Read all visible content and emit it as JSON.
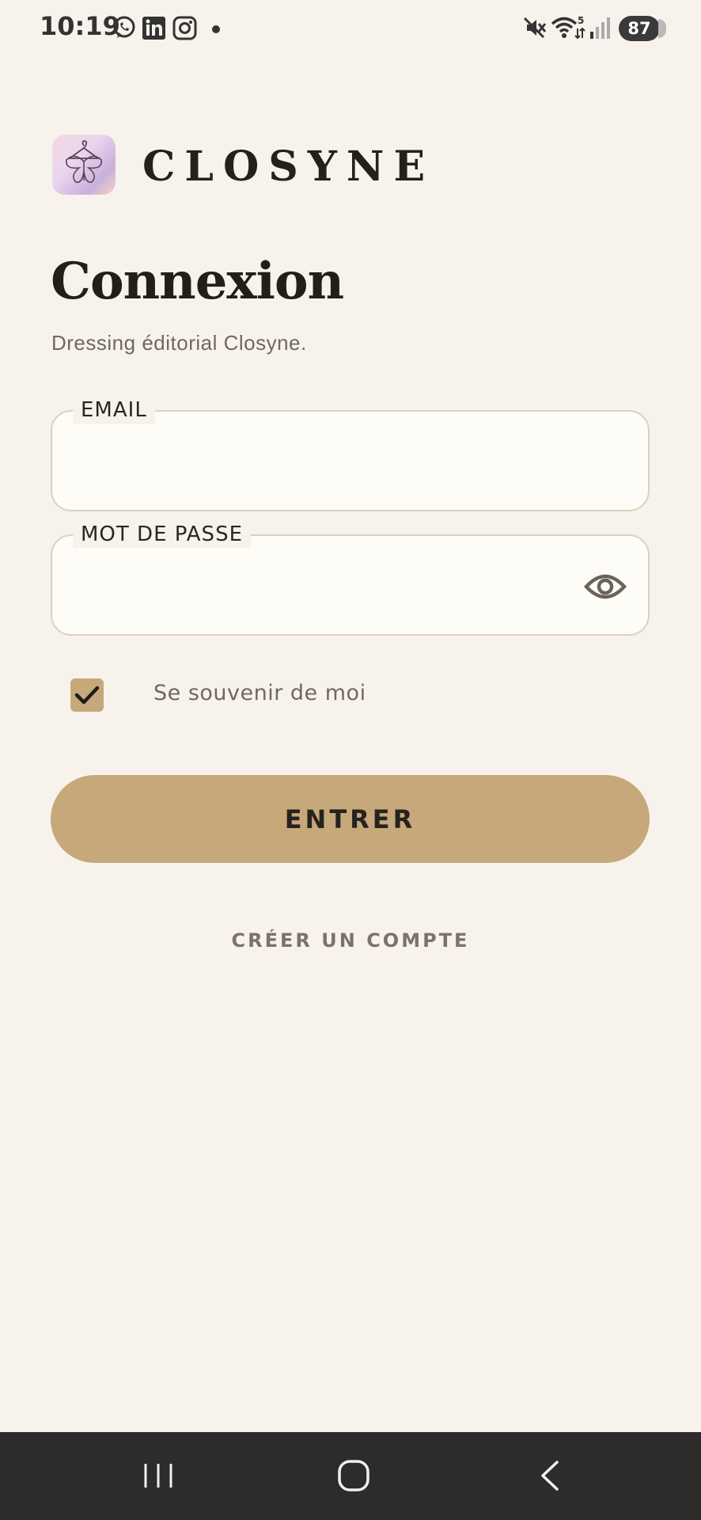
{
  "status_bar": {
    "time": "10:19",
    "battery": "87",
    "icons": [
      "whatsapp-icon",
      "linkedin-icon",
      "instagram-icon",
      "notification-dot",
      "mute-icon",
      "wifi-icon",
      "signal-icon",
      "battery-icon"
    ]
  },
  "brand": {
    "name": "CLOSYNE",
    "logo_icon": "butterfly-hanger-logo"
  },
  "login": {
    "title": "Connexion",
    "subtitle": "Dressing éditorial Closyne.",
    "email_label": "EMAIL",
    "email_value": "",
    "password_label": "MOT DE PASSE",
    "password_value": "",
    "password_toggle_icon": "eye-icon",
    "remember_label": "Se souvenir de moi",
    "remember_checked": true,
    "submit_label": "ENTRER",
    "create_account_label": "CRÉER UN COMPTE"
  },
  "nav_bar": {
    "buttons": [
      "recent-apps-icon",
      "home-icon",
      "back-icon"
    ]
  },
  "colors": {
    "background": "#f7f3ec",
    "accent": "#c7a87b",
    "field_background": "#fefcf7",
    "field_border": "#ddd0bf",
    "text_dark": "#26221e",
    "text_muted": "#6f6860",
    "nav_bar": "#2d2c2b"
  }
}
